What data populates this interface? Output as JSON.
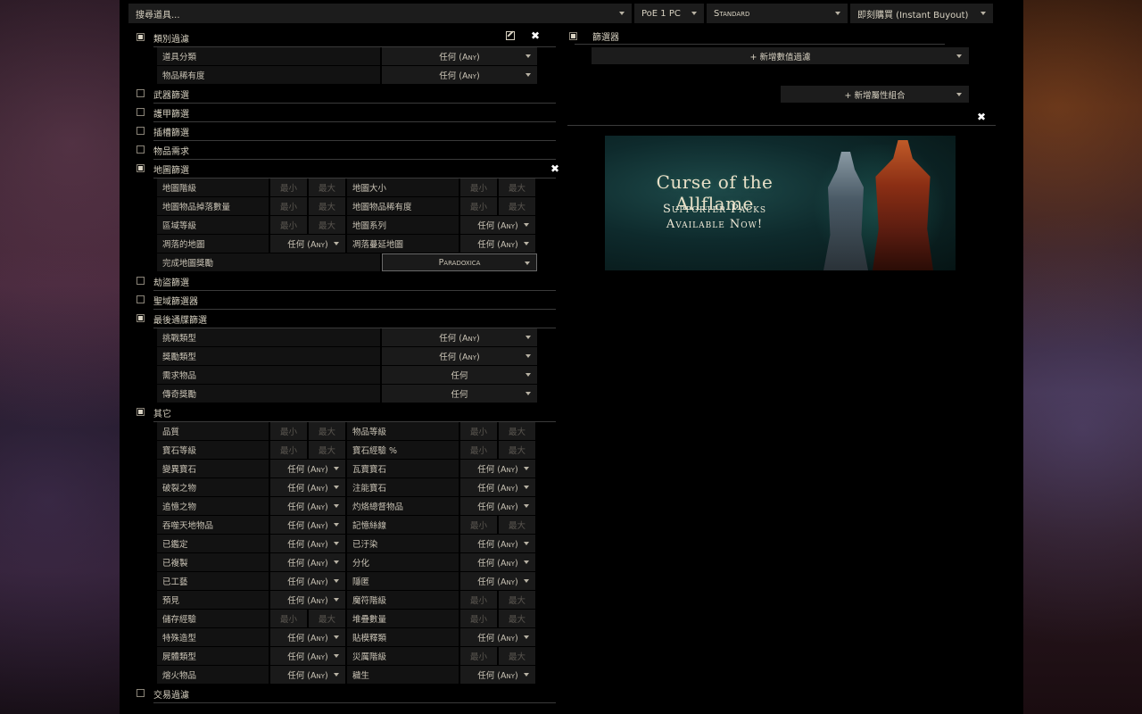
{
  "topbar": {
    "search_placeholder": "搜尋道具...",
    "platform": "PoE 1 PC",
    "league": "Standard",
    "buyout": "即刻購買 (Instant Buyout)"
  },
  "sections": {
    "type_filters": "類別過濾",
    "weapon_filters": "武器篩選",
    "armour_filters": "護甲篩選",
    "socket_filters": "插槽篩選",
    "requirements": "物品需求",
    "map_filters": "地圖篩選",
    "heist_filters": "劫盜篩選",
    "sanctum_filters": "聖域篩選器",
    "ultimatum_filters": "最後通牒篩選",
    "misc": "其它",
    "trade_filters": "交易過濾"
  },
  "common": {
    "any": "任何 (Any)",
    "any_plain": "任何",
    "min": "最小",
    "max": "最大"
  },
  "type_rows": [
    {
      "label": "道具分類",
      "value": "任何 (Any)"
    },
    {
      "label": "物品稀有度",
      "value": "任何 (Any)"
    }
  ],
  "map_rows": {
    "tier": "地圖階級",
    "packsize": "地圖大小",
    "iiq": "地圖物品掉落數量",
    "iir": "地圖物品稀有度",
    "area_level": "區域等級",
    "series": "地圖系列",
    "blighted": "凋落的地圖",
    "blight_ravaged": "凋落蔓延地圖",
    "completion_reward": "完成地圖獎勵",
    "completion_value": "Paradoxica"
  },
  "ultimatum_rows": [
    {
      "label": "挑戰類型",
      "value": "任何 (Any)"
    },
    {
      "label": "獎勵類型",
      "value": "任何 (Any)"
    },
    {
      "label": "需求物品",
      "value": "任何"
    },
    {
      "label": "傳奇獎勵",
      "value": "任何"
    }
  ],
  "misc_rows": [
    {
      "l": "品質",
      "l_type": "range",
      "r": "物品等級",
      "r_type": "range"
    },
    {
      "l": "寶石等級",
      "l_type": "range",
      "r": "寶石經驗 %",
      "r_type": "range"
    },
    {
      "l": "變異寶石",
      "l_type": "select",
      "r": "瓦寶寶石",
      "r_type": "select"
    },
    {
      "l": "破裂之物",
      "l_type": "select",
      "r": "注能寶石",
      "r_type": "select"
    },
    {
      "l": "追憶之物",
      "l_type": "select",
      "r": "灼烙總督物品",
      "r_type": "select"
    },
    {
      "l": "吞噬天地物品",
      "l_type": "select",
      "r": "記憶絲線",
      "r_type": "range"
    },
    {
      "l": "已鑑定",
      "l_type": "select",
      "r": "已汙染",
      "r_type": "select"
    },
    {
      "l": "已複製",
      "l_type": "select",
      "r": "分化",
      "r_type": "select"
    },
    {
      "l": "已工藝",
      "l_type": "select",
      "r": "隱匿",
      "r_type": "select"
    },
    {
      "l": "預見",
      "l_type": "select",
      "r": "魔符階級",
      "r_type": "range"
    },
    {
      "l": "儲存經驗",
      "l_type": "range",
      "r": "堆疊數量",
      "r_type": "range"
    },
    {
      "l": "特殊造型",
      "l_type": "select",
      "r": "貼模釋類",
      "r_type": "select"
    },
    {
      "l": "屍體類型",
      "l_type": "select",
      "r": "災厲階級",
      "r_type": "range"
    },
    {
      "l": "熔火物品",
      "l_type": "select",
      "r": "穢生",
      "r_type": "select"
    }
  ],
  "right": {
    "filters_label": "篩選器",
    "add_stat_filter": "+ 新增數值過濾",
    "add_stat_group": "+ 新增屬性組合"
  },
  "banner": {
    "title": "Curse of the Allflame",
    "line1": "Supporter Packs",
    "line2": "Available Now!"
  }
}
